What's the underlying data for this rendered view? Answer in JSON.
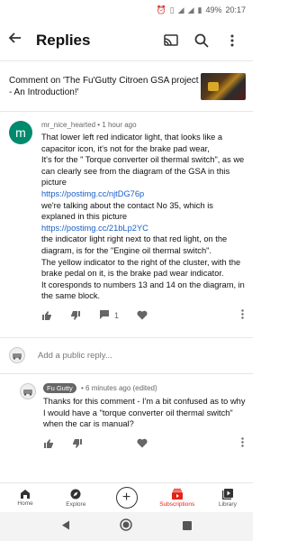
{
  "status_bar": {
    "battery": "49%",
    "time": "20:17"
  },
  "app_bar": {
    "title": "Replies"
  },
  "comment_on": {
    "text": "Comment on 'The Fu'Gutty Citroen GSA project - An Introduction!'"
  },
  "main_comment": {
    "author": "mr_nice_hearted",
    "age": "1 hour ago",
    "lines": [
      {
        "text": "That lower left red indicator light, that looks like  a capacitor icon, it's not for the brake pad wear,",
        "link": false
      },
      {
        "text": "It's for the \" Torque converter oil thermal switch\", as we can clearly see from the diagram of the GSA in this picture",
        "link": false
      },
      {
        "text": "https://postimg.cc/njtDG76p",
        "link": true
      },
      {
        "text": "we're talking about the contact No 35, which is explaned in this picture",
        "link": false
      },
      {
        "text": "https://postimg.cc/21bLp2YC",
        "link": true
      },
      {
        "text": "the indicator light right next to that red light, on the diagram, is for the \"Engine oil thermal switch\".",
        "link": false
      },
      {
        "text": "The yellow indicator to the right of the cluster, with the brake pedal on it, is the brake pad wear indicator.",
        "link": false
      },
      {
        "text": "It coresponds to numbers 13 and 14 on the diagram, in the same block.",
        "link": false
      }
    ],
    "reply_count": "1"
  },
  "add_reply": {
    "placeholder": "Add a public reply..."
  },
  "reply": {
    "author": "Fu Gutty",
    "age": "6 minutes ago (edited)",
    "text": "Thanks for this comment - I'm a bit confused as to why I would have a \"torque converter oil thermal switch\" when the car is manual?"
  },
  "bottom_nav": {
    "home": "Home",
    "explore": "Explore",
    "subscriptions": "Subscriptions",
    "library": "Library"
  },
  "colors": {
    "accent": "#e62117",
    "avatar": "#008a6d",
    "link": "#1a5fc9"
  }
}
